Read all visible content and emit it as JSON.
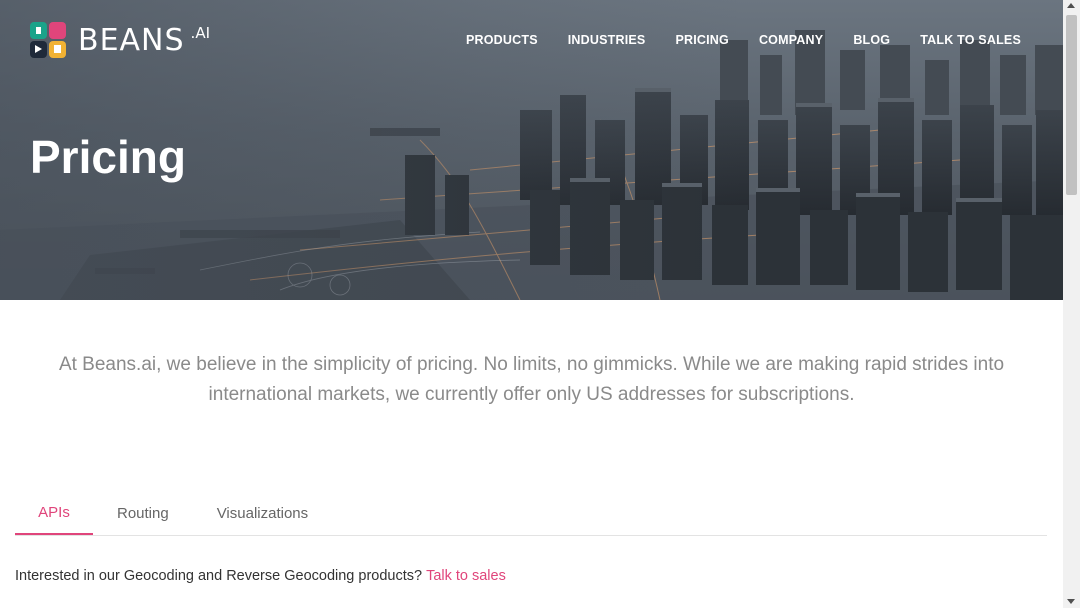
{
  "header": {
    "logo_text": "BEANS",
    "logo_suffix": ".AI",
    "nav": [
      "PRODUCTS",
      "INDUSTRIES",
      "PRICING",
      "COMPANY",
      "BLOG",
      "TALK TO SALES"
    ]
  },
  "hero": {
    "title": "Pricing"
  },
  "intro": {
    "text": "At Beans.ai, we believe in the simplicity of pricing. No limits, no gimmicks. While we are making rapid strides into international markets, we currently offer only US addresses for subscriptions."
  },
  "tabs": [
    {
      "label": "APIs",
      "active": true
    },
    {
      "label": "Routing",
      "active": false
    },
    {
      "label": "Visualizations",
      "active": false
    }
  ],
  "note": {
    "text": "Interested in our Geocoding and Reverse Geocoding products?",
    "link": "Talk to sales"
  },
  "colors": {
    "accent": "#e0457b",
    "hero_bg": "#5a636d",
    "text_muted": "#8a8a8a"
  },
  "icons": [
    "beans-logo-icon",
    "scroll-up-icon",
    "scroll-down-icon"
  ]
}
